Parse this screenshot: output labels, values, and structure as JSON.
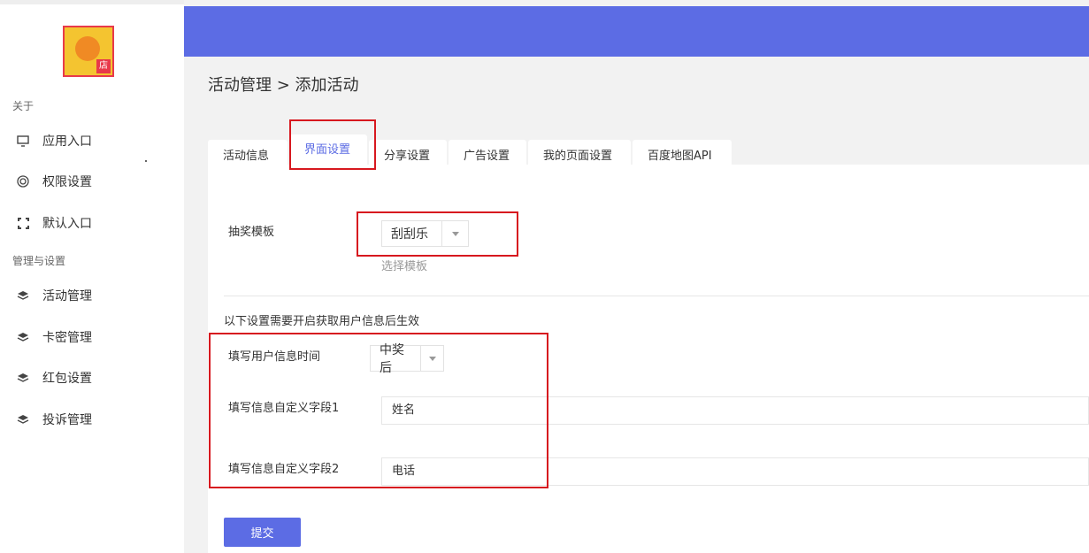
{
  "sidebar": {
    "logo_badge": "店",
    "section_about": "关于",
    "section_manage": "管理与设置",
    "items": [
      {
        "label": "应用入口",
        "icon": "monitor-icon"
      },
      {
        "label": "权限设置",
        "icon": "target-icon"
      },
      {
        "label": "默认入口",
        "icon": "expand-icon"
      },
      {
        "label": "活动管理",
        "icon": "layers-icon"
      },
      {
        "label": "卡密管理",
        "icon": "layers-icon"
      },
      {
        "label": "红包设置",
        "icon": "layers-icon"
      },
      {
        "label": "投诉管理",
        "icon": "layers-icon"
      }
    ]
  },
  "main": {
    "breadcrumb": "活动管理 > 添加活动",
    "tabs": [
      {
        "label": "活动信息"
      },
      {
        "label": "界面设置",
        "active": true
      },
      {
        "label": "分享设置"
      },
      {
        "label": "广告设置"
      },
      {
        "label": "我的页面设置"
      },
      {
        "label": "百度地图API"
      }
    ],
    "form": {
      "template_label": "抽奖模板",
      "template_value": "刮刮乐",
      "template_hint": "选择模板",
      "notice": "以下设置需要开启获取用户信息后生效",
      "time_label": "填写用户信息时间",
      "time_value": "中奖后",
      "field1_label": "填写信息自定义字段1",
      "field1_value": "姓名",
      "field2_label": "填写信息自定义字段2",
      "field2_value": "电话",
      "submit_label": "提交"
    }
  },
  "colors": {
    "accent": "#5c6ce4",
    "highlight_border": "#d7181f"
  }
}
